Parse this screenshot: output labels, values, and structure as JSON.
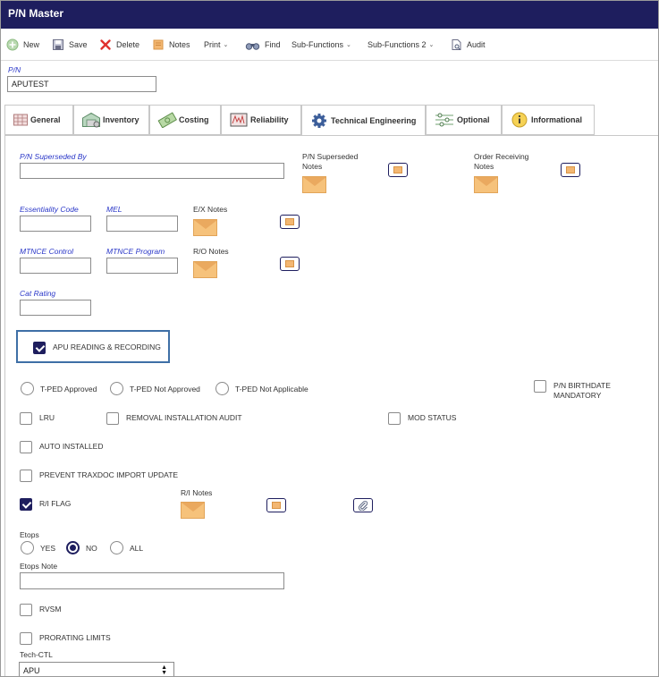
{
  "window": {
    "title": "P/N Master"
  },
  "toolbar": {
    "new": "New",
    "save": "Save",
    "delete": "Delete",
    "notes": "Notes",
    "print": "Print",
    "find": "Find",
    "sub_functions": "Sub-Functions",
    "sub_functions_2": "Sub-Functions 2",
    "audit": "Audit"
  },
  "pn": {
    "label": "P/N",
    "value": "APUTEST"
  },
  "tabs": [
    "General",
    "Inventory",
    "Costing",
    "Reliability",
    "Technical Engineering",
    "Optional",
    "Informational"
  ],
  "active_tab": "Technical Engineering",
  "form": {
    "pn_superseded_by": {
      "label": "P/N Superseded By",
      "value": ""
    },
    "pn_superseded_notes": {
      "label_line1": "P/N Superseded",
      "label_line2": "Notes"
    },
    "order_receiving_notes": {
      "label_line1": "Order Receiving",
      "label_line2": "Notes"
    },
    "essentiality_code": {
      "label": "Essentiality Code",
      "value": ""
    },
    "mel": {
      "label": "MEL",
      "value": ""
    },
    "ex_notes": {
      "label": "E/X Notes"
    },
    "mtnce_control": {
      "label": "MTNCE Control",
      "value": ""
    },
    "mtnce_program": {
      "label": "MTNCE Program",
      "value": ""
    },
    "ro_notes": {
      "label": "R/O Notes"
    },
    "cat_rating": {
      "label": "Cat Rating",
      "value": ""
    },
    "apu_reading": {
      "label": "APU READING & RECORDING",
      "checked": true
    },
    "tped": {
      "options": [
        "T-PED Approved",
        "T-PED Not Approved",
        "T-PED Not Applicable"
      ],
      "selected": null
    },
    "pn_birthdate_mandatory": {
      "label": "P/N BIRTHDATE MANDATORY",
      "checked": false
    },
    "lru": {
      "label": "LRU",
      "checked": false
    },
    "removal_installation_audit": {
      "label": "REMOVAL INSTALLATION AUDIT",
      "checked": false
    },
    "mod_status": {
      "label": "MOD STATUS",
      "checked": false
    },
    "auto_installed": {
      "label": "AUTO INSTALLED",
      "checked": false
    },
    "prevent_traxdoc": {
      "label": "PREVENT TRAXDOC IMPORT UPDATE",
      "checked": false
    },
    "ri_flag": {
      "label": "R/I FLAG",
      "checked": true
    },
    "ri_notes": {
      "label": "R/I Notes"
    },
    "etops": {
      "label": "Etops",
      "options": [
        "YES",
        "NO",
        "ALL"
      ],
      "selected": "NO"
    },
    "etops_note": {
      "label": "Etops Note",
      "value": ""
    },
    "rvsm": {
      "label": "RVSM",
      "checked": false
    },
    "prorating_limits": {
      "label": "PRORATING LIMITS",
      "checked": false
    },
    "tech_ctl": {
      "label": "Tech-CTL",
      "value": "APU"
    }
  },
  "colors": {
    "titlebar": "#1e1e5e",
    "accent": "#1e1e5e",
    "label_blue": "#2a37c8",
    "highlight": "#3e6fa6"
  }
}
